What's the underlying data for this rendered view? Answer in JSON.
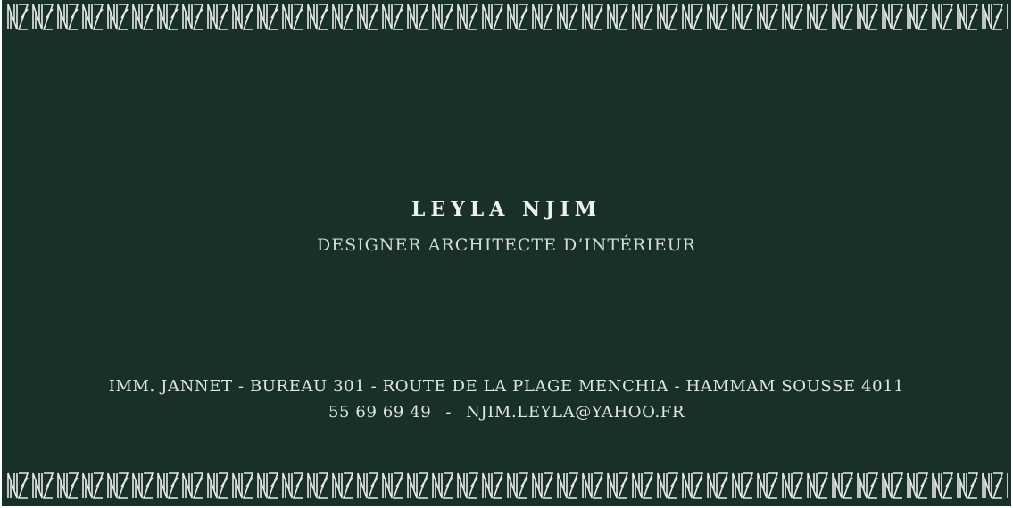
{
  "card": {
    "name": "LEYLA NJIM",
    "title": "DESIGNER ARCHITECTE D’INTÉRIEUR",
    "address": "IMM. JANNET - BUREAU 301 - ROUTE DE LA PLAGE MENCHIA - HAMMAM SOUSSE 4011",
    "phone": "55 69 69 49",
    "separator": "-",
    "email": "NJIM.LEYLA@YAHOO.FR"
  },
  "colors": {
    "background": "#19302a",
    "text": "#e2e5e0",
    "pattern": "#e8ebe6"
  },
  "decoration": {
    "border_pattern": "repeating-N-motif"
  }
}
